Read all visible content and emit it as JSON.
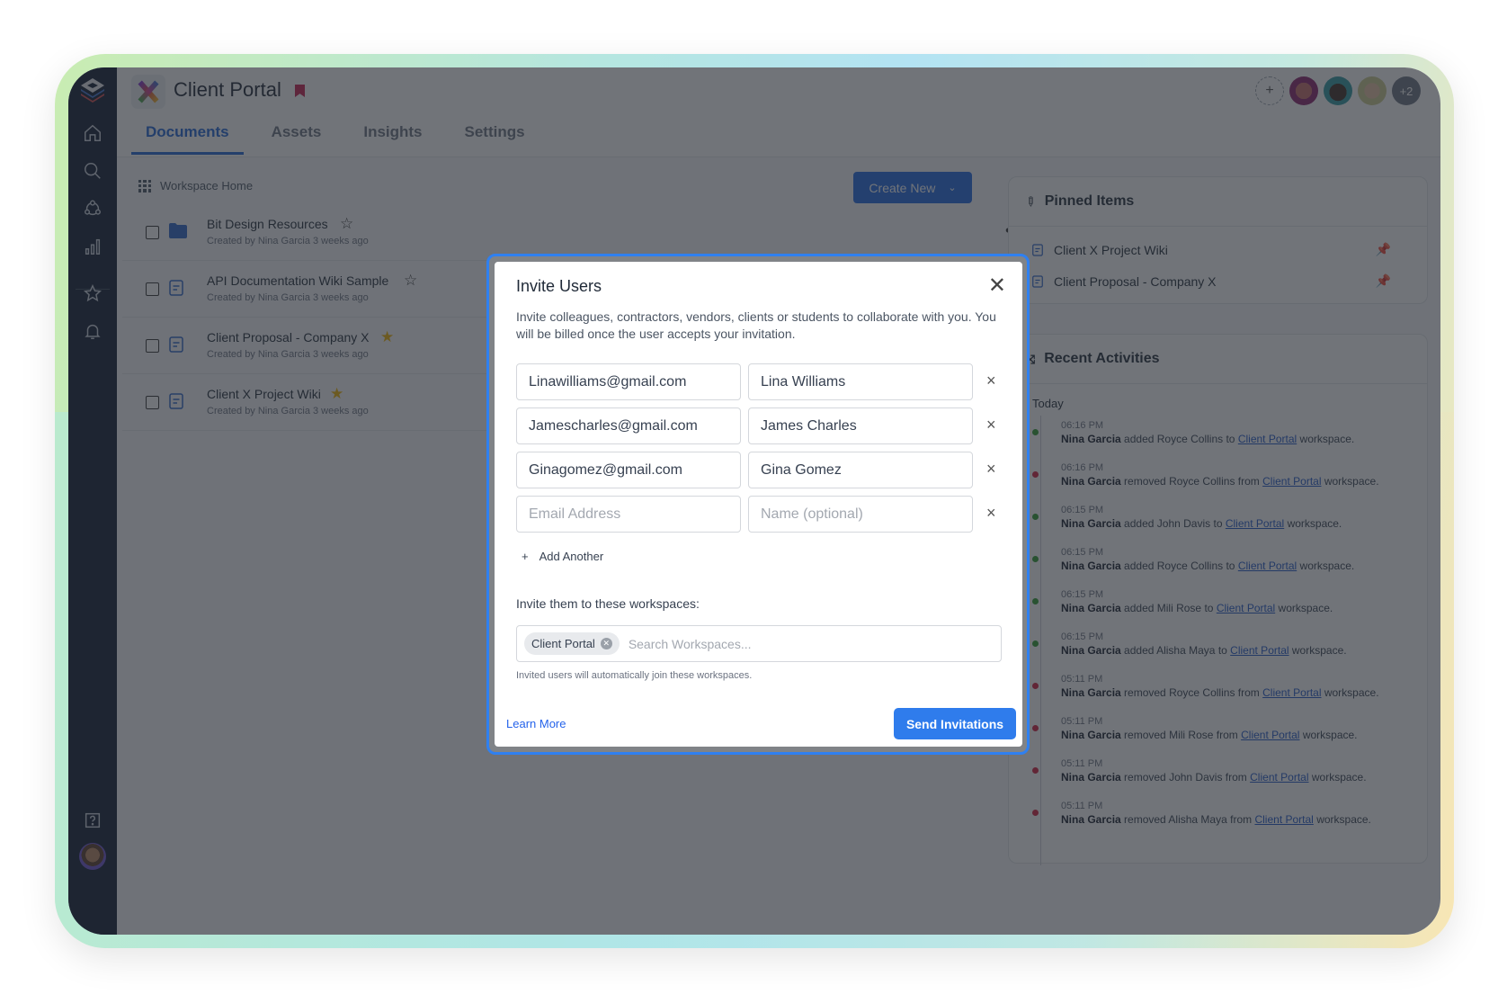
{
  "app": {
    "title": "Client Portal",
    "logo_letter": "X",
    "bookmark_color": "#c81d4e"
  },
  "sidebar": {
    "items": [
      {
        "name": "home",
        "icon": "home-icon"
      },
      {
        "name": "search",
        "icon": "search-icon"
      },
      {
        "name": "network",
        "icon": "network-icon"
      },
      {
        "name": "analytics",
        "icon": "bar-chart-icon"
      },
      {
        "name": "favorites",
        "icon": "star-icon"
      },
      {
        "name": "notifications",
        "icon": "bell-icon"
      },
      {
        "name": "help",
        "icon": "help-icon"
      }
    ]
  },
  "header": {
    "tabs": [
      {
        "label": "Documents",
        "active": true
      },
      {
        "label": "Assets",
        "active": false
      },
      {
        "label": "Insights",
        "active": false
      },
      {
        "label": "Settings",
        "active": false
      }
    ],
    "members_overflow": "+2",
    "add_member": "+"
  },
  "workspace": {
    "breadcrumb": "Workspace Home",
    "create_new_label": "Create New",
    "more_label": "•••",
    "documents": [
      {
        "name": "Bit Design Resources",
        "meta": "Created by Nina Garcia 3 weeks ago",
        "type": "folder",
        "starred": false
      },
      {
        "name": "API Documentation Wiki Sample",
        "meta": "Created by Nina Garcia 3 weeks ago",
        "type": "document",
        "starred": false
      },
      {
        "name": "Client Proposal - Company X",
        "meta": "Created by Nina Garcia 3 weeks ago",
        "type": "document",
        "starred": true
      },
      {
        "name": "Client X Project Wiki",
        "meta": "Created by Nina Garcia 3 weeks ago",
        "type": "document",
        "starred": true
      }
    ]
  },
  "pinned": {
    "title": "Pinned Items",
    "items": [
      "Client X Project Wiki",
      "Client Proposal - Company X"
    ]
  },
  "recent": {
    "title": "Recent Activities",
    "group": "Today",
    "items": [
      {
        "time": "06:16 PM",
        "actor": "Nina Garcia",
        "verb": "added",
        "target": "Royce Collins",
        "prep": "to",
        "workspace": "Client Portal",
        "suffix": "workspace.",
        "status": "added"
      },
      {
        "time": "06:16 PM",
        "actor": "Nina Garcia",
        "verb": "removed",
        "target": "Royce Collins",
        "prep": "from",
        "workspace": "Client Portal",
        "suffix": "workspace.",
        "status": "removed"
      },
      {
        "time": "06:15 PM",
        "actor": "Nina Garcia",
        "verb": "added",
        "target": "John Davis",
        "prep": "to",
        "workspace": "Client Portal",
        "suffix": "workspace.",
        "status": "added"
      },
      {
        "time": "06:15 PM",
        "actor": "Nina Garcia",
        "verb": "added",
        "target": "Royce Collins",
        "prep": "to",
        "workspace": "Client Portal",
        "suffix": "workspace.",
        "status": "added"
      },
      {
        "time": "06:15 PM",
        "actor": "Nina Garcia",
        "verb": "added",
        "target": "Mili Rose",
        "prep": "to",
        "workspace": "Client Portal",
        "suffix": "workspace.",
        "status": "added"
      },
      {
        "time": "06:15 PM",
        "actor": "Nina Garcia",
        "verb": "added",
        "target": "Alisha Maya",
        "prep": "to",
        "workspace": "Client Portal",
        "suffix": "workspace.",
        "status": "added"
      },
      {
        "time": "05:11 PM",
        "actor": "Nina Garcia",
        "verb": "removed",
        "target": "Royce Collins",
        "prep": "from",
        "workspace": "Client Portal",
        "suffix": "workspace.",
        "status": "removed"
      },
      {
        "time": "05:11 PM",
        "actor": "Nina Garcia",
        "verb": "removed",
        "target": "Mili Rose",
        "prep": "from",
        "workspace": "Client Portal",
        "suffix": "workspace.",
        "status": "removed"
      },
      {
        "time": "05:11 PM",
        "actor": "Nina Garcia",
        "verb": "removed",
        "target": "John Davis",
        "prep": "from",
        "workspace": "Client Portal",
        "suffix": "workspace.",
        "status": "removed"
      },
      {
        "time": "05:11 PM",
        "actor": "Nina Garcia",
        "verb": "removed",
        "target": "Alisha Maya",
        "prep": "from",
        "workspace": "Client Portal",
        "suffix": "workspace.",
        "status": "removed"
      }
    ],
    "status_colors": {
      "added": "#2e9b2e",
      "removed": "#d21c3c"
    }
  },
  "modal": {
    "title": "Invite Users",
    "description": "Invite colleagues, contractors, vendors, clients or students to collaborate with you. You will be billed once the user accepts your invitation.",
    "rows": [
      {
        "email": "Linawilliams@gmail.com",
        "name": "Lina Williams"
      },
      {
        "email": "Jamescharles@gmail.com",
        "name": "James Charles"
      },
      {
        "email": "Ginagomez@gmail.com",
        "name": "Gina Gomez"
      },
      {
        "email": "",
        "name": ""
      }
    ],
    "email_placeholder": "Email Address",
    "name_placeholder": "Name (optional)",
    "remove_glyph": "×",
    "add_another_label": "Add Another",
    "workspaces_label": "Invite them to these workspaces:",
    "selected_workspaces": [
      "Client Portal"
    ],
    "workspace_search_placeholder": "Search Workspaces...",
    "workspaces_hint": "Invited users will automatically join these workspaces.",
    "learn_more_label": "Learn More",
    "send_label": "Send Invitations",
    "accent": "#2f7cec"
  }
}
